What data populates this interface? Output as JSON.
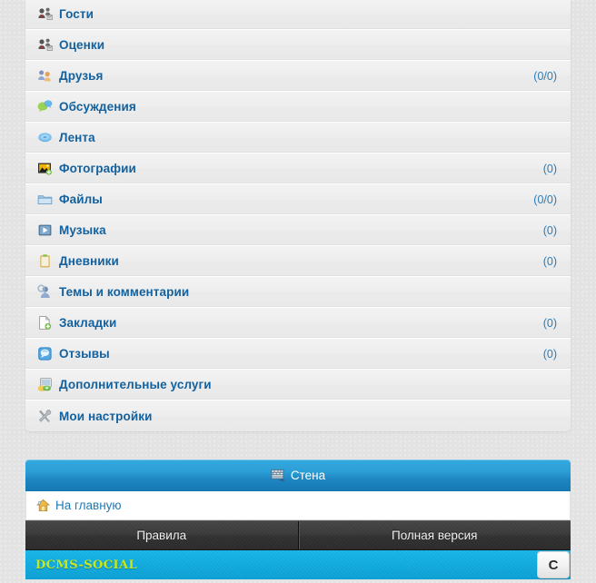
{
  "menu": {
    "items": [
      {
        "label": "Гости",
        "count": "",
        "icon": "guests-icon"
      },
      {
        "label": "Оценки",
        "count": "",
        "icon": "ratings-icon"
      },
      {
        "label": "Друзья",
        "count": "(0/0)",
        "icon": "friends-icon"
      },
      {
        "label": "Обсуждения",
        "count": "",
        "icon": "discussions-icon"
      },
      {
        "label": "Лента",
        "count": "",
        "icon": "feed-icon"
      },
      {
        "label": "Фотографии",
        "count": "(0)",
        "icon": "photos-icon"
      },
      {
        "label": "Файлы",
        "count": "(0/0)",
        "icon": "files-icon"
      },
      {
        "label": "Музыка",
        "count": "(0)",
        "icon": "music-icon"
      },
      {
        "label": "Дневники",
        "count": "(0)",
        "icon": "diaries-icon"
      },
      {
        "label": "Темы и комментарии",
        "count": "",
        "icon": "topics-comments-icon"
      },
      {
        "label": "Закладки",
        "count": "(0)",
        "icon": "bookmarks-icon"
      },
      {
        "label": "Отзывы",
        "count": "(0)",
        "icon": "reviews-icon"
      },
      {
        "label": "Дополнительные услуги",
        "count": "",
        "icon": "extra-services-icon"
      },
      {
        "label": "Мои настройки",
        "count": "",
        "icon": "my-settings-icon"
      }
    ]
  },
  "bottom": {
    "wall_label": "Стена",
    "home_label": "На главную",
    "rules_label": "Правила",
    "full_version_label": "Полная версия"
  },
  "footer": {
    "brand": "DCMS-SOCIAL",
    "counter_label": "C"
  },
  "colors": {
    "link_blue": "#13619e",
    "count_blue": "#2b7cb8",
    "wall_blue": "#2b9ed6",
    "footer_cyan": "#0fa9dd",
    "brand_yellow_green": "#c8e81b",
    "dark_button": "#3a3a3a",
    "row_gray": "#eeeeee"
  }
}
